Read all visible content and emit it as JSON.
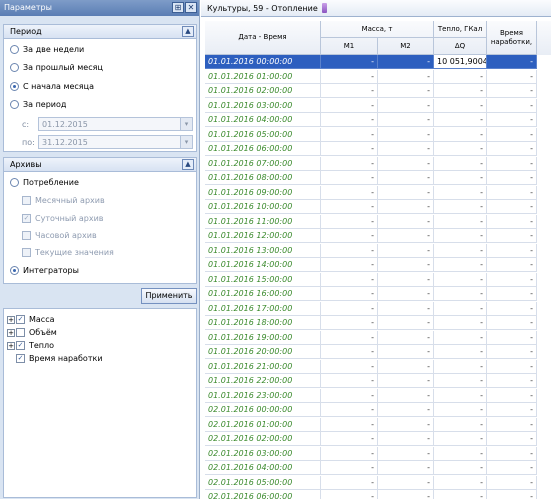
{
  "left_panel": {
    "title": "Параметры",
    "pin_glyph": "⊞",
    "close_glyph": "✕"
  },
  "period": {
    "header": "Период",
    "options": [
      {
        "label": "За две недели",
        "selected": false
      },
      {
        "label": "За прошлый месяц",
        "selected": false
      },
      {
        "label": "С начала месяца",
        "selected": true
      },
      {
        "label": "За период",
        "selected": false
      }
    ],
    "from_label": "с:",
    "from_value": "01.12.2015",
    "to_label": "по:",
    "to_value": "31.12.2015"
  },
  "archives": {
    "header": "Архивы",
    "consumption_label": "Потребление",
    "items": [
      {
        "label": "Месячный архив",
        "checked": false
      },
      {
        "label": "Суточный архив",
        "checked": true
      },
      {
        "label": "Часовой архив",
        "checked": false
      },
      {
        "label": "Текущие значения",
        "checked": false
      }
    ],
    "integrators_label": "Интеграторы",
    "integrators_selected": true
  },
  "apply_label": "Применить",
  "tree": [
    {
      "label": "Масса",
      "expander": "+",
      "checked": true
    },
    {
      "label": "Объём",
      "expander": "+",
      "checked": false
    },
    {
      "label": "Тепло",
      "expander": "+",
      "checked": true
    },
    {
      "label": "Время наработки",
      "expander": "",
      "checked": true
    }
  ],
  "right_panel": {
    "title": "Культуры, 59 - Отопление"
  },
  "grid": {
    "headers": {
      "date": "Дата - Время",
      "mass": "Масса, т",
      "m1": "M1",
      "m2": "M2",
      "heat": "Тепло, ГКал",
      "dq": "ΔQ",
      "runtime": "Время наработки,"
    },
    "rows": [
      {
        "date": "01.01.2016 00:00:00",
        "m1": "-",
        "m2": "-",
        "dq": "10 051,9004",
        "rt": "-"
      },
      {
        "date": "01.01.2016 01:00:00",
        "m1": "-",
        "m2": "-",
        "dq": "-",
        "rt": "-"
      },
      {
        "date": "01.01.2016 02:00:00",
        "m1": "-",
        "m2": "-",
        "dq": "-",
        "rt": "-"
      },
      {
        "date": "01.01.2016 03:00:00",
        "m1": "-",
        "m2": "-",
        "dq": "-",
        "rt": "-"
      },
      {
        "date": "01.01.2016 04:00:00",
        "m1": "-",
        "m2": "-",
        "dq": "-",
        "rt": "-"
      },
      {
        "date": "01.01.2016 05:00:00",
        "m1": "-",
        "m2": "-",
        "dq": "-",
        "rt": "-"
      },
      {
        "date": "01.01.2016 06:00:00",
        "m1": "-",
        "m2": "-",
        "dq": "-",
        "rt": "-"
      },
      {
        "date": "01.01.2016 07:00:00",
        "m1": "-",
        "m2": "-",
        "dq": "-",
        "rt": "-"
      },
      {
        "date": "01.01.2016 08:00:00",
        "m1": "-",
        "m2": "-",
        "dq": "-",
        "rt": "-"
      },
      {
        "date": "01.01.2016 09:00:00",
        "m1": "-",
        "m2": "-",
        "dq": "-",
        "rt": "-"
      },
      {
        "date": "01.01.2016 10:00:00",
        "m1": "-",
        "m2": "-",
        "dq": "-",
        "rt": "-"
      },
      {
        "date": "01.01.2016 11:00:00",
        "m1": "-",
        "m2": "-",
        "dq": "-",
        "rt": "-"
      },
      {
        "date": "01.01.2016 12:00:00",
        "m1": "-",
        "m2": "-",
        "dq": "-",
        "rt": "-"
      },
      {
        "date": "01.01.2016 13:00:00",
        "m1": "-",
        "m2": "-",
        "dq": "-",
        "rt": "-"
      },
      {
        "date": "01.01.2016 14:00:00",
        "m1": "-",
        "m2": "-",
        "dq": "-",
        "rt": "-"
      },
      {
        "date": "01.01.2016 15:00:00",
        "m1": "-",
        "m2": "-",
        "dq": "-",
        "rt": "-"
      },
      {
        "date": "01.01.2016 16:00:00",
        "m1": "-",
        "m2": "-",
        "dq": "-",
        "rt": "-"
      },
      {
        "date": "01.01.2016 17:00:00",
        "m1": "-",
        "m2": "-",
        "dq": "-",
        "rt": "-"
      },
      {
        "date": "01.01.2016 18:00:00",
        "m1": "-",
        "m2": "-",
        "dq": "-",
        "rt": "-"
      },
      {
        "date": "01.01.2016 19:00:00",
        "m1": "-",
        "m2": "-",
        "dq": "-",
        "rt": "-"
      },
      {
        "date": "01.01.2016 20:00:00",
        "m1": "-",
        "m2": "-",
        "dq": "-",
        "rt": "-"
      },
      {
        "date": "01.01.2016 21:00:00",
        "m1": "-",
        "m2": "-",
        "dq": "-",
        "rt": "-"
      },
      {
        "date": "01.01.2016 22:00:00",
        "m1": "-",
        "m2": "-",
        "dq": "-",
        "rt": "-"
      },
      {
        "date": "01.01.2016 23:00:00",
        "m1": "-",
        "m2": "-",
        "dq": "-",
        "rt": "-"
      },
      {
        "date": "02.01.2016 00:00:00",
        "m1": "-",
        "m2": "-",
        "dq": "-",
        "rt": "-"
      },
      {
        "date": "02.01.2016 01:00:00",
        "m1": "-",
        "m2": "-",
        "dq": "-",
        "rt": "-"
      },
      {
        "date": "02.01.2016 02:00:00",
        "m1": "-",
        "m2": "-",
        "dq": "-",
        "rt": "-"
      },
      {
        "date": "02.01.2016 03:00:00",
        "m1": "-",
        "m2": "-",
        "dq": "-",
        "rt": "-"
      },
      {
        "date": "02.01.2016 04:00:00",
        "m1": "-",
        "m2": "-",
        "dq": "-",
        "rt": "-"
      },
      {
        "date": "02.01.2016 05:00:00",
        "m1": "-",
        "m2": "-",
        "dq": "-",
        "rt": "-"
      },
      {
        "date": "02.01.2016 06:00:00",
        "m1": "-",
        "m2": "-",
        "dq": "-",
        "rt": "-"
      }
    ]
  },
  "colors": {
    "selection": "#2d5fbf",
    "date_text": "#3a8a2c",
    "panel_bg": "#d9e4f2",
    "title_bar": "#5a7db4"
  }
}
